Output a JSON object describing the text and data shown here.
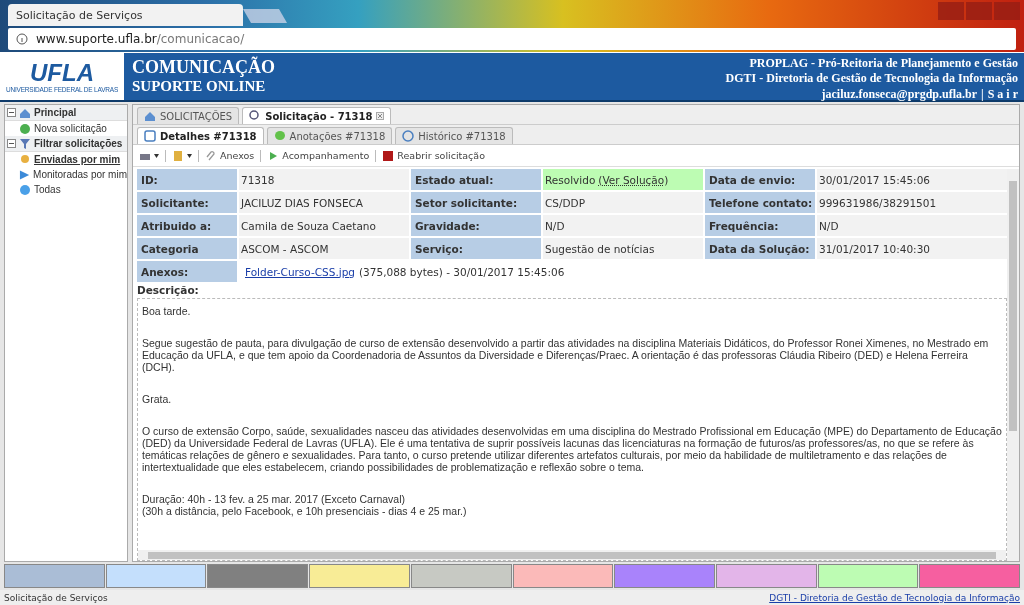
{
  "browser": {
    "tab_title": "Solicitação de Serviços",
    "url_host": "www.suporte.ufla.br",
    "url_path": "/comunicacao/"
  },
  "header": {
    "logo": "UFLA",
    "logo_caption": "UNIVERSIDADE FEDERAL DE LAVRAS",
    "title": "COMUNICAÇÃO",
    "subtitle": "SUPORTE ONLINE",
    "org_lines": [
      "PROPLAG - Pró-Reitoria de Planejamento e Gestão",
      "DGTI - Diretoria de Gestão de Tecnologia da Informação"
    ],
    "user": "jaciluz.fonseca@prgdp.ufla.br",
    "separator": "|",
    "logout": "S a i r"
  },
  "sidebar": {
    "groups": [
      {
        "label": "Principal",
        "kind": "home",
        "expanded": true,
        "children": [
          {
            "label": "Nova solicitação",
            "kind": "add",
            "selected": false
          }
        ]
      },
      {
        "label": "Filtrar solicitações",
        "kind": "filter",
        "expanded": true,
        "children": [
          {
            "label": "Enviadas por mim",
            "kind": "user",
            "selected": true
          },
          {
            "label": "Monitoradas por mim",
            "kind": "monitor",
            "selected": false
          },
          {
            "label": "Todas",
            "kind": "all",
            "selected": false
          }
        ]
      }
    ]
  },
  "tabs": [
    {
      "label": "SOLICITAÇÕES",
      "kind": "home",
      "selected": false,
      "closable": false
    },
    {
      "label": "Solicitação - 71318",
      "kind": "search",
      "selected": true,
      "closable": true
    }
  ],
  "subtabs": [
    {
      "label": "Detalhes #71318",
      "kind": "details",
      "selected": true
    },
    {
      "label": "Anotações #71318",
      "kind": "notes",
      "selected": false
    },
    {
      "label": "Histórico #71318",
      "kind": "history",
      "selected": false
    }
  ],
  "toolbar": [
    {
      "kind": "print"
    },
    {
      "kind": "edit"
    },
    {
      "kind": "attach",
      "label": "Anexos"
    },
    {
      "kind": "follow",
      "label": "Acompanhamento"
    },
    {
      "kind": "reopen",
      "label": "Reabrir solicitação"
    }
  ],
  "fields": [
    [
      {
        "label": "ID:",
        "value": "71318"
      },
      {
        "label": "Estado atual:",
        "value": "Resolvido",
        "link": "(Ver Solução)",
        "highlighted": true
      },
      {
        "label": "Data de envio:",
        "value": "30/01/2017 15:45:06"
      }
    ],
    [
      {
        "label": "Solicitante:",
        "value": "JACILUZ DIAS FONSECA"
      },
      {
        "label": "Setor solicitante:",
        "value": "CS/DDP"
      },
      {
        "label": "Telefone contato:",
        "value": "999631986/38291501"
      }
    ],
    [
      {
        "label": "Atribuido a:",
        "value": "Camila de Souza Caetano"
      },
      {
        "label": "Gravidade:",
        "value": "N/D"
      },
      {
        "label": "Frequência:",
        "value": "N/D"
      }
    ],
    [
      {
        "label": "Categoria",
        "value": "ASCOM - ASCOM"
      },
      {
        "label": "Serviço:",
        "value": "Sugestão de notícias"
      },
      {
        "label": "Data da Solução:",
        "value": "31/01/2017 10:40:30"
      }
    ]
  ],
  "attachments": {
    "label": "Anexos:",
    "file": "Folder-Curso-CSS.jpg",
    "info": "(375,088 bytes) - 30/01/2017 15:45:06"
  },
  "description": {
    "label": "Descrição:",
    "paragraphs": [
      "Boa tarde.",
      "Segue sugestão de pauta, para divulgação de curso de extensão desenvolvido a partir das atividades na disciplina Materiais Didáticos, do Professor Ronei Ximenes, no Mestrado em Educação da UFLA, e que tem apoio da Coordenadoria de Assuntos da Diversidade e Diferenças/Praec. A orientação é das professoras Cláudia Ribeiro (DED) e Helena Ferreira (DCH).",
      "Grata.",
      "O curso de extensão Corpo, saúde, sexualidades nasceu das atividades desenvolvidas em uma disciplina do Mestrado Profissional em Educação (MPE) do Departamento de Educação (DED) da Universidade Federal de Lavras (UFLA). Ele é uma tentativa de suprir possíveis lacunas das licenciaturas na formação de futuros/as professores/as, no que se refere às temáticas relações de gênero e sexualidades. Para tanto, o curso pretende utilizar diferentes artefatos culturais, por meio da habilidade de multiletramento e das relações de intertextualidade que eles estabelecem, criando possibilidades de problematização e reflexão sobre o tema.",
      "Duração: 40h - 13 fev. a 25 mar. 2017 (Exceto Carnaval)\n(30h a distância, pelo Facebook, e 10h presenciais - dias 4 e 25 mar.)"
    ]
  },
  "swatches": [
    {
      "color": "#aabdd6"
    },
    {
      "color": "#c4dffc"
    },
    {
      "color": "#808080"
    },
    {
      "color": "#f8ec96"
    },
    {
      "color": "#c7c9c3"
    },
    {
      "color": "#fbbab9"
    },
    {
      "color": "#a983fb"
    },
    {
      "color": "#e3b5e9"
    },
    {
      "color": "#bdfcb3"
    },
    {
      "color": "#f65fa0"
    }
  ],
  "status_bar": {
    "left": "Solicitação de Serviços",
    "right": "DGTI - Diretoria de Gestão de Tecnologia da Informação"
  }
}
